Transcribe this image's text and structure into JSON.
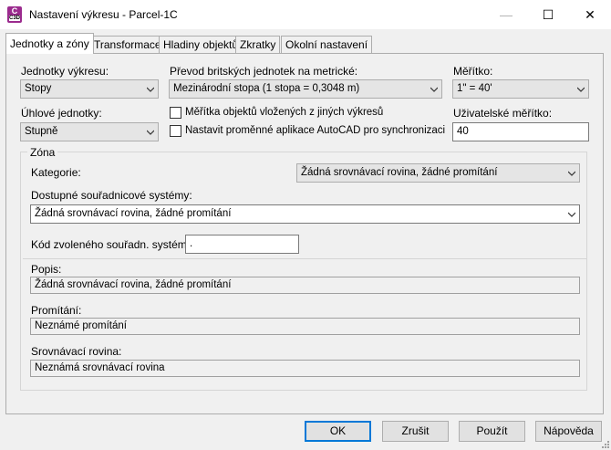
{
  "window": {
    "title": "Nastavení výkresu - Parcel-1C",
    "icon_top": "C",
    "icon_bottom": "C3D",
    "minimize_glyph": "—",
    "maximize_glyph": "☐",
    "close_glyph": "✕"
  },
  "tabs": [
    {
      "label": "Jednotky a zóny",
      "active": true
    },
    {
      "label": "Transformace"
    },
    {
      "label": "Hladiny objektů"
    },
    {
      "label": "Zkratky"
    },
    {
      "label": "Okolní nastavení"
    }
  ],
  "units": {
    "drawing_units_label": "Jednotky výkresu:",
    "drawing_units_value": "Stopy",
    "imperial_label": "Převod britských jednotek na metrické:",
    "imperial_value": "Mezinárodní stopa (1 stopa = 0,3048 m)",
    "scale_label": "Měřítko:",
    "scale_value": "1\" = 40'",
    "angular_label": "Úhlové jednotky:",
    "angular_value": "Stupně",
    "scale_inserted_label": "Měřítka objektů vložených z jiných výkresů",
    "autocad_vars_label": "Nastavit proměnné aplikace AutoCAD pro synchronizaci",
    "custom_scale_label": "Uživatelské měřítko:",
    "custom_scale_value": "40"
  },
  "zone": {
    "group_label": "Zóna",
    "category_label": "Kategorie:",
    "category_value": "Žádná srovnávací rovina, žádné promítání",
    "available_label": "Dostupné souřadnicové systémy:",
    "available_value": "Žádná srovnávací rovina, žádné promítání",
    "code_label": "Kód zvoleného souřadn. systému:",
    "code_value": ".",
    "description_label": "Popis:",
    "description_value": "Žádná srovnávací rovina, žádné promítání",
    "projection_label": "Promítání:",
    "projection_value": "Neznámé promítání",
    "datum_label": "Srovnávací rovina:",
    "datum_value": "Neznámá srovnávací rovina"
  },
  "buttons": {
    "ok": "OK",
    "cancel": "Zrušit",
    "apply": "Použít",
    "help": "Nápověda"
  }
}
